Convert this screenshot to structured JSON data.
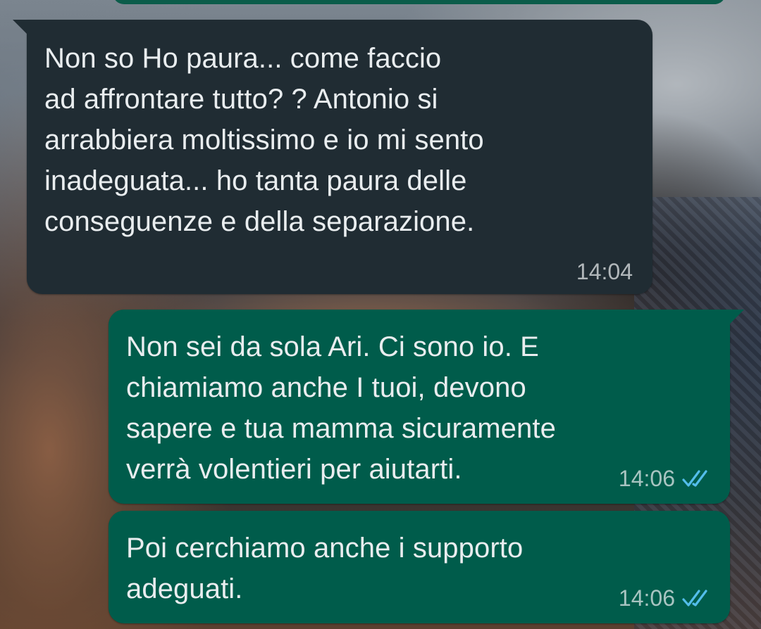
{
  "chat": {
    "messages": [
      {
        "direction": "incoming",
        "text": "Non so Ho paura... come faccio\nad affrontare tutto? ? Antonio si\narrabbiera moltissimo e io mi sento\ninadeguata... ho tanta paura delle\nconseguenze e della separazione.",
        "time": "14:04"
      },
      {
        "direction": "outgoing",
        "text": "Non sei da sola Ari. Ci sono io. E\nchiamiamo anche I tuoi, devono\nsapere e tua mamma sicuramente\nverrà volentieri per aiutarti.",
        "time": "14:06",
        "status_icon": "double-check-read-icon"
      },
      {
        "direction": "outgoing",
        "text": "Poi cerchiamo anche i supporto\nadeguati.",
        "time": "14:06",
        "status_icon": "double-check-read-icon"
      }
    ]
  },
  "colors": {
    "incoming_bubble": "#202c33",
    "outgoing_bubble": "#005c4b",
    "text": "#e9edef",
    "read_ticks": "#53bdeb"
  }
}
